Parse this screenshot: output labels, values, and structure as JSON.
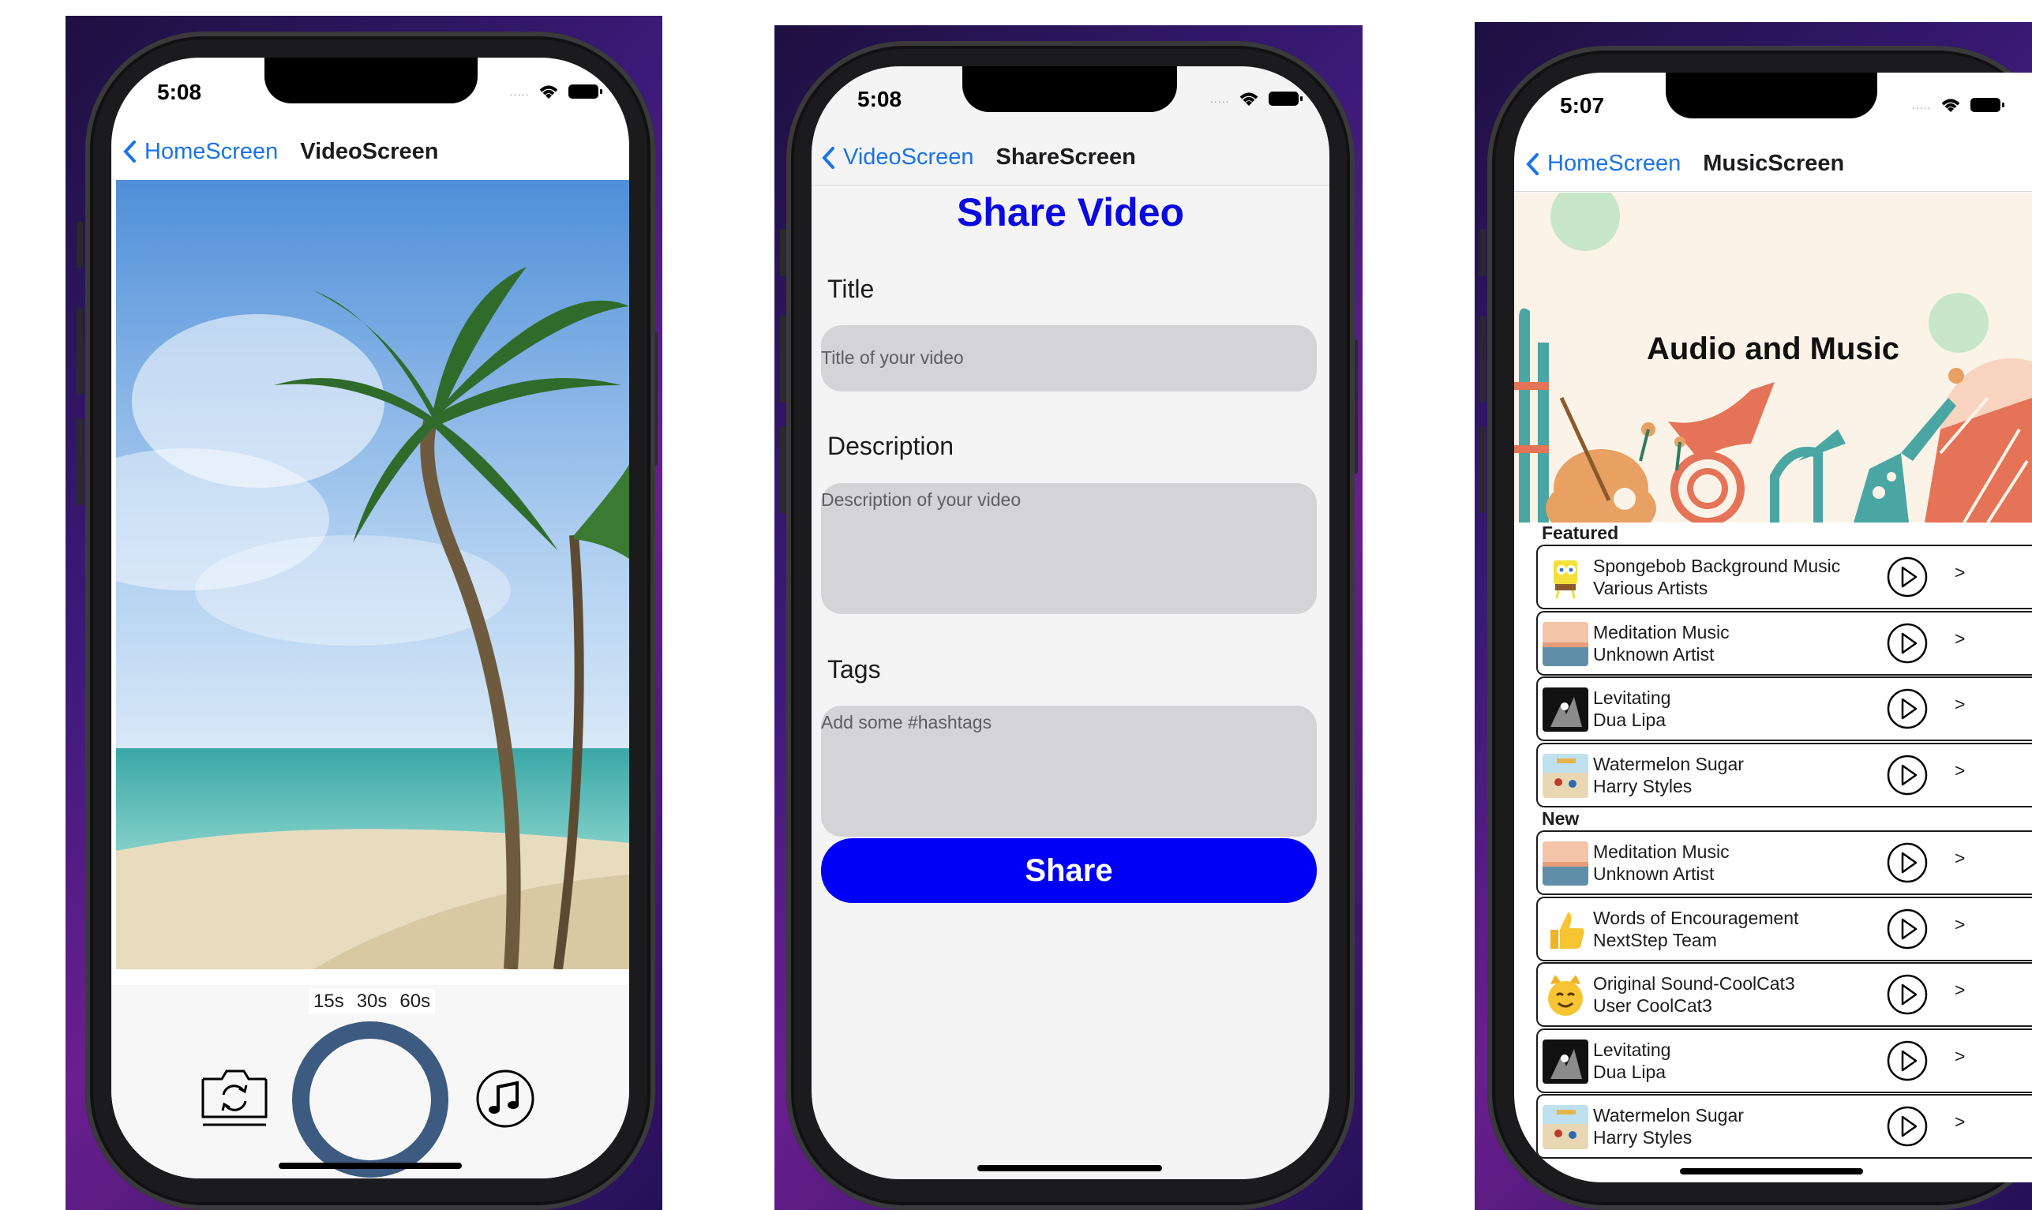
{
  "status_bar": {
    "video_time": "5:08",
    "share_time": "5:08",
    "music_time": "5:07",
    "signal_dots": "....."
  },
  "video_screen": {
    "back_label": "HomeScreen",
    "title": "VideoScreen",
    "durations": [
      "15s",
      "30s",
      "60s"
    ],
    "icons": {
      "flip_camera": "camera-flip-icon",
      "record": "record-ring-icon",
      "music": "music-note-icon"
    }
  },
  "share_screen": {
    "back_label": "VideoScreen",
    "title": "ShareScreen",
    "heading": "Share Video",
    "title_label": "Title",
    "title_placeholder": "Title of your video",
    "description_label": "Description",
    "description_placeholder": "Description of your video",
    "tags_label": "Tags",
    "tags_placeholder": "Add some #hashtags",
    "share_button": "Share",
    "accent_color": "#0000f5"
  },
  "music_screen": {
    "back_label": "HomeScreen",
    "title": "MusicScreen",
    "banner_title": "Audio and Music",
    "featured_label": "Featured",
    "new_label": "New",
    "chevron": ">",
    "featured": [
      {
        "song": "Spongebob Background Music",
        "artist": "Various Artists",
        "thumb": "sponge"
      },
      {
        "song": "Meditation Music",
        "artist": "Unknown Artist",
        "thumb": "sunset"
      },
      {
        "song": "Levitating",
        "artist": "Dua Lipa",
        "thumb": "dark"
      },
      {
        "song": "Watermelon Sugar",
        "artist": "Harry Styles",
        "thumb": "beachpic"
      }
    ],
    "new": [
      {
        "song": "Meditation Music",
        "artist": "Unknown Artist",
        "thumb": "sunset"
      },
      {
        "song": "Words of Encouragement",
        "artist": "NextStep Team",
        "thumb": "thumbsup"
      },
      {
        "song": "Original Sound-CoolCat3",
        "artist": "User CoolCat3",
        "thumb": "cat"
      },
      {
        "song": "Levitating",
        "artist": "Dua Lipa",
        "thumb": "dark"
      },
      {
        "song": "Watermelon Sugar",
        "artist": "Harry Styles",
        "thumb": "beachpic"
      }
    ]
  }
}
